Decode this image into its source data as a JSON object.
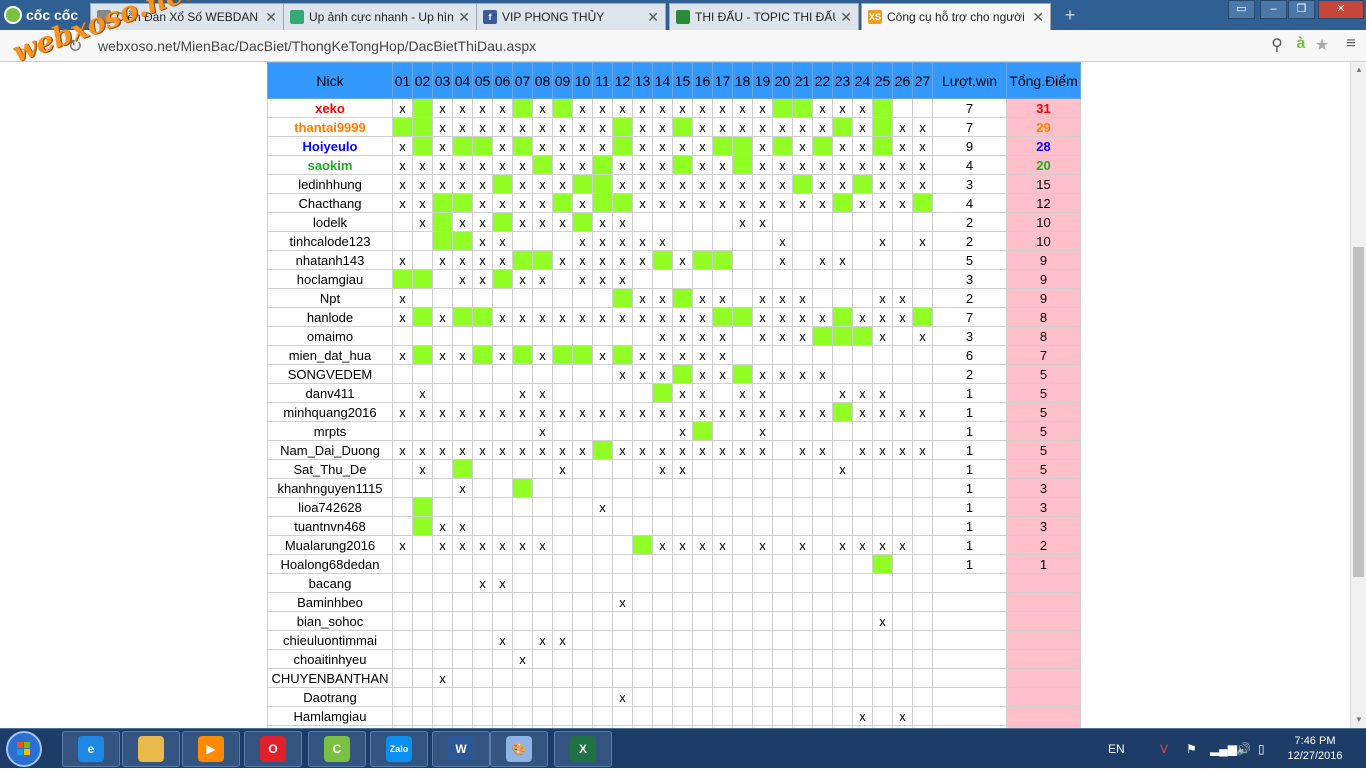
{
  "browser": {
    "brand": "cốc cốc",
    "tabs": [
      {
        "title": "Diễn Đàn Xổ Số WEBDAN",
        "icon": "document-icon"
      },
      {
        "title": "Up ảnh cực nhanh - Up hìn",
        "icon": "image-icon"
      },
      {
        "title": "VIP PHONG THỦY",
        "icon": "facebook-icon"
      },
      {
        "title": "THI ĐẤU - TOPIC THI ĐẤU",
        "icon": "forum-icon"
      },
      {
        "title": "Công cụ hỗ trợ cho người",
        "icon": "xs-icon",
        "active": true
      }
    ],
    "url": "webxoso.net/MienBac/DacBiet/ThongKeTongHop/DacBietThiDau.aspx",
    "watermark": "webxoso.net"
  },
  "table": {
    "headers": {
      "nick": "Nick",
      "days": [
        "01",
        "02",
        "03",
        "04",
        "05",
        "06",
        "07",
        "08",
        "09",
        "10",
        "11",
        "12",
        "13",
        "14",
        "15",
        "16",
        "17",
        "18",
        "19",
        "20",
        "21",
        "22",
        "23",
        "24",
        "25",
        "26",
        "27"
      ],
      "wins": "Lượt.win",
      "points": "Tổng.Điểm"
    },
    "colors": {
      "header": "#3399ff",
      "win_cell": "#91ff26",
      "points_cell": "#ffc0cb",
      "first": "#ff0000",
      "second": "#ff7f00",
      "third": "#0000ff",
      "fourth": "#22aa22"
    },
    "rows": [
      {
        "nick": "xeko",
        "cells": "x.xxxx.x.xxxxxxxxxx..xxx.",
        "wins": "7",
        "points": "31",
        "rank": 1
      },
      {
        "nick": "thantai9999",
        "cells": "..xxxxxxxxx.xx.xxxxxxx.x.xx.",
        "wins": "7",
        "points": "29",
        "rank": 2
      },
      {
        "nick": "Hoiyeulo",
        "cells": "x.x..x.xxxx.xxxx..x.x.xx.xxx",
        "wins": "9",
        "points": "28",
        "rank": 3
      },
      {
        "nick": "saokim",
        "cells": "xxxxxxx.xx.xxx.xx.xxxxxxxxx",
        "wins": "4",
        "points": "20",
        "rank": 4
      },
      {
        "nick": "ledinhhung",
        "cells": "xxxxx.xxx..xxxxxxxxx.xx.xxx",
        "wins": "3",
        "points": "15",
        "rank": 0
      },
      {
        "nick": "Chacthang",
        "cells": "xx..xxxx.x..xxxxxxxxxx.xxx.xx",
        "wins": "4",
        "points": "12",
        "rank": 0
      },
      {
        "nick": "lodelk",
        "cells": " x.xx.xxx.xx     xx        ",
        "wins": "2",
        "points": "10",
        "rank": 0
      },
      {
        "nick": "tinhcalode123",
        "cells": "  ..xx   xxxxx     x    x x ",
        "wins": "2",
        "points": "10",
        "rank": 0
      },
      {
        "nick": "nhatanh143",
        "cells": "x xxxx..xxxxx.x..  x xx     ",
        "wins": "5",
        "points": "9",
        "rank": 0
      },
      {
        "nick": "hoclamgiau",
        "cells": ".. xx.xx xxx                ",
        "wins": "3",
        "points": "9",
        "rank": 0
      },
      {
        "nick": "Npt",
        "cells": "x          .xx.xx xxx   xx  ",
        "wins": "2",
        "points": "9",
        "rank": 0
      },
      {
        "nick": "hanlode",
        "cells": "x.x..xxxxxxxxxxx..xxxx.xxx. ",
        "wins": "7",
        "points": "8",
        "rank": 0
      },
      {
        "nick": "omaimo",
        "cells": "             xxxx xxx...x x ",
        "wins": "3",
        "points": "8",
        "rank": 0
      },
      {
        "nick": "mien_dat_hua",
        "cells": "x.xx.x.x..x.xxxxx          ",
        "wins": "6",
        "points": "7",
        "rank": 0
      },
      {
        "nick": "SONGVEDEM",
        "cells": "           xxx.xx.xxxx      ",
        "wins": "2",
        "points": "5",
        "rank": 0
      },
      {
        "nick": "danv411",
        "cells": " x    xx     .xx xx   xxx   ",
        "wins": "1",
        "points": "5",
        "rank": 0
      },
      {
        "nick": "minhquang2016",
        "cells": "xxxxxxxxxxxxxxxxxxxxxx.xxxxx",
        "wins": "1",
        "points": "5",
        "rank": 0
      },
      {
        "nick": "mrpts",
        "cells": "       x      x.  x         ",
        "wins": "1",
        "points": "5",
        "rank": 0
      },
      {
        "nick": "Nam_Dai_Duong",
        "cells": "xxxxxxxxxx.xxxxxxxx xx xxxx ",
        "wins": "1",
        "points": "5",
        "rank": 0
      },
      {
        "nick": "Sat_Thu_De",
        "cells": " x .    x    xx       x     ",
        "wins": "1",
        "points": "5",
        "rank": 0
      },
      {
        "nick": "khanhnguyen1115",
        "cells": "   x  .                     ",
        "wins": "1",
        "points": "3",
        "rank": 0
      },
      {
        "nick": "lioa742628",
        "cells": " .        x                 ",
        "wins": "1",
        "points": "3",
        "rank": 0
      },
      {
        "nick": "tuantnvn468",
        "cells": " .xx                        ",
        "wins": "1",
        "points": "3",
        "rank": 0
      },
      {
        "nick": "Mualarung2016",
        "cells": "x xxxxxx    .xxxx x x xxxx  ",
        "wins": "1",
        "points": "2",
        "rank": 0
      },
      {
        "nick": "Hoalong68dedan",
        "cells": "                        .   ",
        "wins": "1",
        "points": "1",
        "rank": 0
      },
      {
        "nick": "bacang",
        "cells": "    xx                      ",
        "wins": "",
        "points": "",
        "rank": 0
      },
      {
        "nick": "Baminhbeo",
        "cells": "           x                ",
        "wins": "",
        "points": "",
        "rank": 0
      },
      {
        "nick": "bian_sohoc",
        "cells": "                        x   ",
        "wins": "",
        "points": "",
        "rank": 0
      },
      {
        "nick": "chieuluontimmai",
        "cells": "     x xx                   ",
        "wins": "",
        "points": "",
        "rank": 0
      },
      {
        "nick": "choaitinhyeu",
        "cells": "      x                     ",
        "wins": "",
        "points": "",
        "rank": 0
      },
      {
        "nick": "CHUYENBANTHAN",
        "cells": "  x                         ",
        "wins": "",
        "points": "",
        "rank": 0
      },
      {
        "nick": "Daotrang",
        "cells": "           x                ",
        "wins": "",
        "points": "",
        "rank": 0
      },
      {
        "nick": "Hamlamgiau",
        "cells": "                       x x  ",
        "wins": "",
        "points": "",
        "rank": 0
      },
      {
        "nick": "",
        "cells": "                           ",
        "wins": "",
        "points": "",
        "rank": 0
      }
    ]
  },
  "taskbar": {
    "apps": [
      {
        "name": "internet-explorer-icon",
        "color": "#1e88e5",
        "label": "e"
      },
      {
        "name": "file-explorer-icon",
        "color": "#e8b84a",
        "label": ""
      },
      {
        "name": "media-player-icon",
        "color": "#ff8a00",
        "label": "▶"
      },
      {
        "name": "opera-icon",
        "color": "#e0202b",
        "label": "O"
      },
      {
        "name": "coccoc-icon",
        "color": "#7ac143",
        "label": "C"
      },
      {
        "name": "zalo-icon",
        "color": "#0a8ff0",
        "label": "Zalo"
      },
      {
        "name": "word-icon",
        "color": "#2b5797",
        "label": "W"
      },
      {
        "name": "paint-icon",
        "color": "#8fb4e3",
        "label": "🎨"
      },
      {
        "name": "excel-icon",
        "color": "#1f7244",
        "label": "X"
      }
    ],
    "language": "EN",
    "time": "7:46 PM",
    "date": "12/27/2016"
  }
}
